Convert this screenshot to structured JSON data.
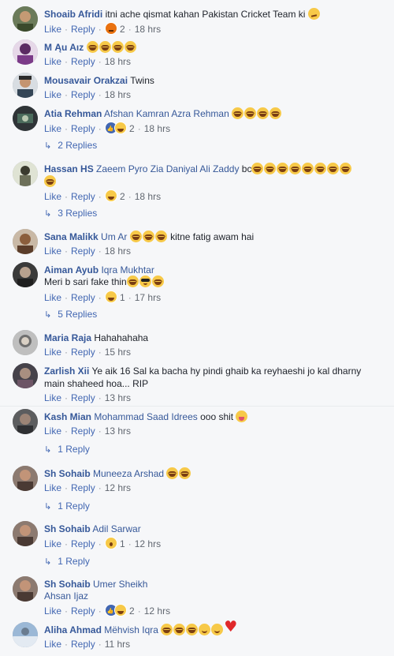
{
  "like_label": "Like",
  "reply_label": "Reply",
  "comments": [
    {
      "name": "Shoaib Afridi",
      "mention": "",
      "text": "itni ache qismat kahan Pakistan Cricket Team ki",
      "count": "2",
      "time": "18 hrs"
    },
    {
      "name": "M Ąu Aıᴢ",
      "mention": "",
      "text": "",
      "count": "",
      "time": "18 hrs"
    },
    {
      "name": "Mousavair Orakzai",
      "mention": "",
      "text": "Twins",
      "count": "",
      "time": "18 hrs"
    },
    {
      "name": "Atia Rehman",
      "mention": "Afshan Kamran Azra Rehman",
      "text": "",
      "count": "2",
      "time": "18 hrs",
      "replies": "2 Replies"
    },
    {
      "name": "Hassan HS",
      "mention": "Zaeem Pyro Zia Daniyal Ali Zaddy",
      "text": "bc",
      "count": "2",
      "time": "18 hrs",
      "replies": "3 Replies"
    },
    {
      "name": "Sana Malikk",
      "mention": "Um Ar",
      "text": "kitne fatig awam hai",
      "count": "",
      "time": "18 hrs"
    },
    {
      "name": "Aiman Ayub",
      "mention": "Iqra Mukhtar",
      "text": "Meri b sari fake thin",
      "count": "1",
      "time": "17 hrs",
      "replies": "5 Replies"
    },
    {
      "name": "Maria Raja",
      "mention": "",
      "text": "Hahahahaha",
      "count": "",
      "time": "15 hrs"
    },
    {
      "name": "Zarlish Xii",
      "mention": "",
      "text": "Ye aik 16 Sal ka bacha hy pindi ghaib ka reyhaeshi jo kal dharny",
      "text2": "main shaheed hoa... RIP",
      "count": "",
      "time": "13 hrs"
    },
    {
      "name": "Kash Mian",
      "mention": "Mohammad Saad Idrees",
      "text": "ooo shit",
      "count": "",
      "time": "13 hrs",
      "replies": "1 Reply"
    },
    {
      "name": "Sh Sohaib",
      "mention": "Muneeza Arshad",
      "text": "",
      "count": "",
      "time": "12 hrs",
      "replies": "1 Reply"
    },
    {
      "name": "Sh Sohaib",
      "mention": "Adil Sarwar",
      "text": "",
      "count": "1",
      "time": "12 hrs",
      "replies": "1 Reply"
    },
    {
      "name": "Sh Sohaib",
      "mention": "Umer Sheikh",
      "mention2": "Ahsan Ijaz",
      "text": "",
      "count": "2",
      "time": "12 hrs"
    },
    {
      "name": "Aliha Ahmad",
      "mention": "Mëhvish Iqra",
      "text": "",
      "count": "",
      "time": "11 hrs"
    }
  ]
}
